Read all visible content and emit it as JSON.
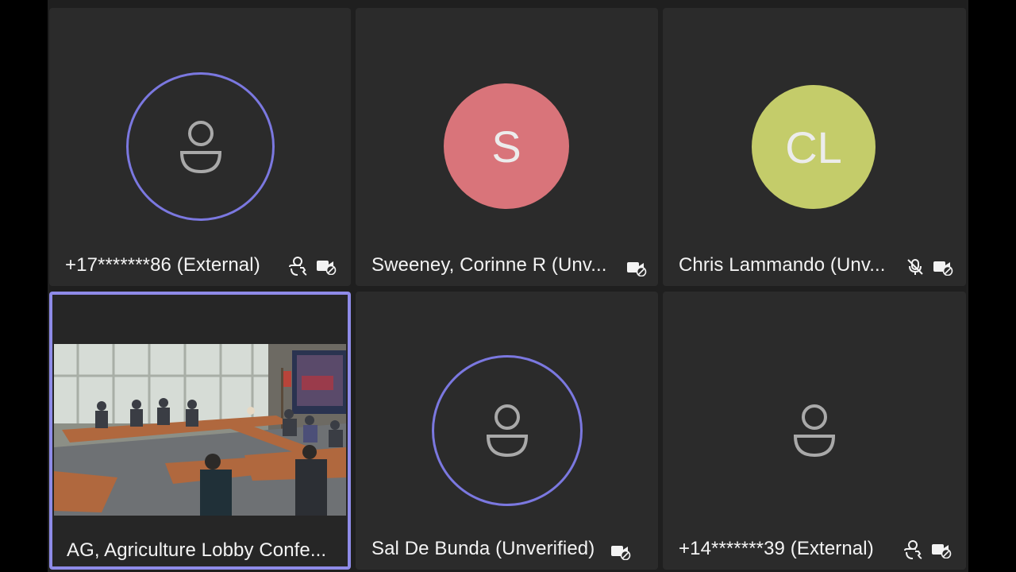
{
  "participants": [
    {
      "name": "+17*******86 (External)",
      "avatar": "person-icon",
      "speaking_ring": true,
      "icons": [
        "phone-person-icon",
        "video-off-icon"
      ]
    },
    {
      "name": "Sweeney, Corinne R (Unv...",
      "initials": "S",
      "avatar_color": "#d9747a",
      "icons": [
        "video-off-icon"
      ]
    },
    {
      "name": "Chris Lammando (Unv...",
      "initials": "CL",
      "avatar_color": "#c4cc6a",
      "icons": [
        "mic-muted-icon",
        "video-off-icon"
      ]
    },
    {
      "name": "AG, Agriculture Lobby Confe...",
      "video": true,
      "active": true,
      "icons": []
    },
    {
      "name": "Sal De Bunda (Unverified)",
      "avatar": "person-icon",
      "speaking_ring": true,
      "icons": [
        "video-off-icon"
      ]
    },
    {
      "name": "+14*******39 (External)",
      "avatar": "person-icon",
      "speaking_ring": false,
      "icons": [
        "phone-person-icon",
        "video-off-icon"
      ]
    }
  ],
  "colors": {
    "ring": "#7b78e0",
    "active_border": "#8e8be8",
    "tile_bg": "#2b2b2b",
    "stage_bg": "#1f1f1f"
  }
}
